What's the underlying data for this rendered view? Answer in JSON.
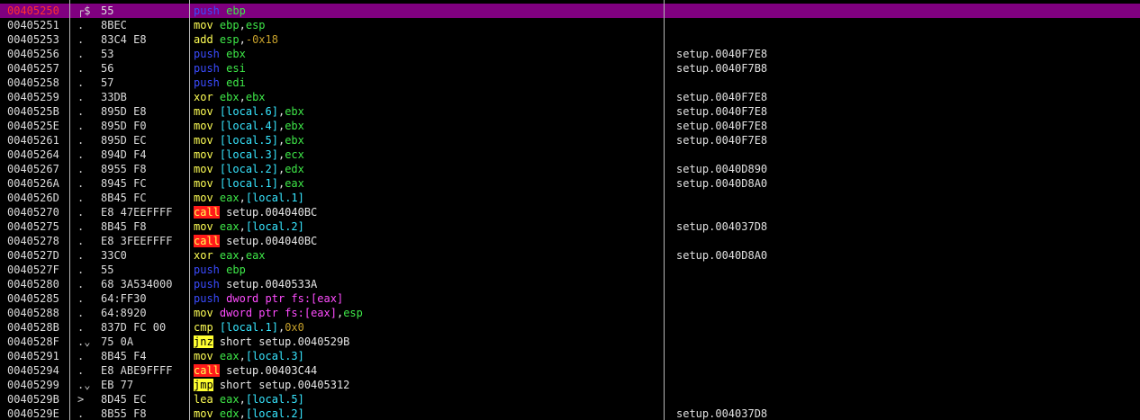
{
  "rows": [
    {
      "addr": "00405250",
      "mark": "┌$",
      "hex": "55",
      "selected": true,
      "asm": [
        [
          "push",
          "push"
        ],
        [
          " ",
          "txt"
        ],
        [
          "ebp",
          "reg"
        ]
      ],
      "comment": ""
    },
    {
      "addr": "00405251",
      "mark": ".",
      "hex": "8BEC",
      "asm": [
        [
          "mov",
          "mn"
        ],
        [
          " ",
          "txt"
        ],
        [
          "ebp",
          "reg"
        ],
        [
          ",",
          "txt"
        ],
        [
          "esp",
          "reg"
        ]
      ],
      "comment": ""
    },
    {
      "addr": "00405253",
      "mark": ".",
      "hex": "83C4 E8",
      "asm": [
        [
          "add",
          "mn"
        ],
        [
          " ",
          "txt"
        ],
        [
          "esp",
          "reg"
        ],
        [
          ",",
          "txt"
        ],
        [
          "-0x18",
          "num"
        ]
      ],
      "comment": ""
    },
    {
      "addr": "00405256",
      "mark": ".",
      "hex": "53",
      "asm": [
        [
          "push",
          "push"
        ],
        [
          " ",
          "txt"
        ],
        [
          "ebx",
          "reg"
        ]
      ],
      "comment": "setup.0040F7E8"
    },
    {
      "addr": "00405257",
      "mark": ".",
      "hex": "56",
      "asm": [
        [
          "push",
          "push"
        ],
        [
          " ",
          "txt"
        ],
        [
          "esi",
          "reg"
        ]
      ],
      "comment": "setup.0040F7B8"
    },
    {
      "addr": "00405258",
      "mark": ".",
      "hex": "57",
      "asm": [
        [
          "push",
          "push"
        ],
        [
          " ",
          "txt"
        ],
        [
          "edi",
          "reg"
        ]
      ],
      "comment": ""
    },
    {
      "addr": "00405259",
      "mark": ".",
      "hex": "33DB",
      "asm": [
        [
          "xor",
          "mn"
        ],
        [
          " ",
          "txt"
        ],
        [
          "ebx",
          "reg"
        ],
        [
          ",",
          "txt"
        ],
        [
          "ebx",
          "reg"
        ]
      ],
      "comment": "setup.0040F7E8"
    },
    {
      "addr": "0040525B",
      "mark": ".",
      "hex": "895D E8",
      "asm": [
        [
          "mov",
          "mn"
        ],
        [
          " ",
          "txt"
        ],
        [
          "[local.6]",
          "mem"
        ],
        [
          ",",
          "txt"
        ],
        [
          "ebx",
          "reg"
        ]
      ],
      "comment": "setup.0040F7E8"
    },
    {
      "addr": "0040525E",
      "mark": ".",
      "hex": "895D F0",
      "asm": [
        [
          "mov",
          "mn"
        ],
        [
          " ",
          "txt"
        ],
        [
          "[local.4]",
          "mem"
        ],
        [
          ",",
          "txt"
        ],
        [
          "ebx",
          "reg"
        ]
      ],
      "comment": "setup.0040F7E8"
    },
    {
      "addr": "00405261",
      "mark": ".",
      "hex": "895D EC",
      "asm": [
        [
          "mov",
          "mn"
        ],
        [
          " ",
          "txt"
        ],
        [
          "[local.5]",
          "mem"
        ],
        [
          ",",
          "txt"
        ],
        [
          "ebx",
          "reg"
        ]
      ],
      "comment": "setup.0040F7E8"
    },
    {
      "addr": "00405264",
      "mark": ".",
      "hex": "894D F4",
      "asm": [
        [
          "mov",
          "mn"
        ],
        [
          " ",
          "txt"
        ],
        [
          "[local.3]",
          "mem"
        ],
        [
          ",",
          "txt"
        ],
        [
          "ecx",
          "reg"
        ]
      ],
      "comment": ""
    },
    {
      "addr": "00405267",
      "mark": ".",
      "hex": "8955 F8",
      "asm": [
        [
          "mov",
          "mn"
        ],
        [
          " ",
          "txt"
        ],
        [
          "[local.2]",
          "mem"
        ],
        [
          ",",
          "txt"
        ],
        [
          "edx",
          "reg"
        ]
      ],
      "comment": "setup.0040D890"
    },
    {
      "addr": "0040526A",
      "mark": ".",
      "hex": "8945 FC",
      "asm": [
        [
          "mov",
          "mn"
        ],
        [
          " ",
          "txt"
        ],
        [
          "[local.1]",
          "mem"
        ],
        [
          ",",
          "txt"
        ],
        [
          "eax",
          "reg"
        ]
      ],
      "comment": "setup.0040D8A0"
    },
    {
      "addr": "0040526D",
      "mark": ".",
      "hex": "8B45 FC",
      "asm": [
        [
          "mov",
          "mn"
        ],
        [
          " ",
          "txt"
        ],
        [
          "eax",
          "reg"
        ],
        [
          ",",
          "txt"
        ],
        [
          "[local.1]",
          "mem"
        ]
      ],
      "comment": ""
    },
    {
      "addr": "00405270",
      "mark": ".",
      "hex": "E8 47EEFFFF",
      "asm": [
        [
          "call",
          "call"
        ],
        [
          " setup.004040BC",
          "txt"
        ]
      ],
      "comment": ""
    },
    {
      "addr": "00405275",
      "mark": ".",
      "hex": "8B45 F8",
      "asm": [
        [
          "mov",
          "mn"
        ],
        [
          " ",
          "txt"
        ],
        [
          "eax",
          "reg"
        ],
        [
          ",",
          "txt"
        ],
        [
          "[local.2]",
          "mem"
        ]
      ],
      "comment": "setup.004037D8"
    },
    {
      "addr": "00405278",
      "mark": ".",
      "hex": "E8 3FEEFFFF",
      "asm": [
        [
          "call",
          "call"
        ],
        [
          " setup.004040BC",
          "txt"
        ]
      ],
      "comment": ""
    },
    {
      "addr": "0040527D",
      "mark": ".",
      "hex": "33C0",
      "asm": [
        [
          "xor",
          "mn"
        ],
        [
          " ",
          "txt"
        ],
        [
          "eax",
          "reg"
        ],
        [
          ",",
          "txt"
        ],
        [
          "eax",
          "reg"
        ]
      ],
      "comment": "setup.0040D8A0"
    },
    {
      "addr": "0040527F",
      "mark": ".",
      "hex": "55",
      "asm": [
        [
          "push",
          "push"
        ],
        [
          " ",
          "txt"
        ],
        [
          "ebp",
          "reg"
        ]
      ],
      "comment": ""
    },
    {
      "addr": "00405280",
      "mark": ".",
      "hex": "68 3A534000",
      "asm": [
        [
          "push",
          "push"
        ],
        [
          " setup.0040533A",
          "txt"
        ]
      ],
      "comment": ""
    },
    {
      "addr": "00405285",
      "mark": ".",
      "hex": "64:FF30",
      "asm": [
        [
          "push",
          "push"
        ],
        [
          " ",
          "txt"
        ],
        [
          "dword ptr fs:[eax]",
          "seg"
        ]
      ],
      "comment": ""
    },
    {
      "addr": "00405288",
      "mark": ".",
      "hex": "64:8920",
      "asm": [
        [
          "mov",
          "mn"
        ],
        [
          " ",
          "txt"
        ],
        [
          "dword ptr fs:[eax]",
          "seg"
        ],
        [
          ",",
          "txt"
        ],
        [
          "esp",
          "reg"
        ]
      ],
      "comment": ""
    },
    {
      "addr": "0040528B",
      "mark": ".",
      "hex": "837D FC 00",
      "asm": [
        [
          "cmp",
          "mn"
        ],
        [
          " ",
          "txt"
        ],
        [
          "[local.1]",
          "mem"
        ],
        [
          ",",
          "txt"
        ],
        [
          "0x0",
          "num"
        ]
      ],
      "comment": ""
    },
    {
      "addr": "0040528F",
      "mark": ".⌄",
      "hex": "75 0A",
      "asm": [
        [
          "jnz",
          "jmp"
        ],
        [
          " short setup.0040529B",
          "txt"
        ]
      ],
      "comment": ""
    },
    {
      "addr": "00405291",
      "mark": ".",
      "hex": "8B45 F4",
      "asm": [
        [
          "mov",
          "mn"
        ],
        [
          " ",
          "txt"
        ],
        [
          "eax",
          "reg"
        ],
        [
          ",",
          "txt"
        ],
        [
          "[local.3]",
          "mem"
        ]
      ],
      "comment": ""
    },
    {
      "addr": "00405294",
      "mark": ".",
      "hex": "E8 ABE9FFFF",
      "asm": [
        [
          "call",
          "call"
        ],
        [
          " setup.00403C44",
          "txt"
        ]
      ],
      "comment": ""
    },
    {
      "addr": "00405299",
      "mark": ".⌄",
      "hex": "EB 77",
      "asm": [
        [
          "jmp",
          "jmp"
        ],
        [
          " short setup.00405312",
          "txt"
        ]
      ],
      "comment": ""
    },
    {
      "addr": "0040529B",
      "mark": ">",
      "hex": "8D45 EC",
      "asm": [
        [
          "lea",
          "mn"
        ],
        [
          " ",
          "txt"
        ],
        [
          "eax",
          "reg"
        ],
        [
          ",",
          "txt"
        ],
        [
          "[local.5]",
          "mem"
        ]
      ],
      "comment": ""
    },
    {
      "addr": "0040529E",
      "mark": ".",
      "hex": "8B55 F8",
      "asm": [
        [
          "mov",
          "mn"
        ],
        [
          " ",
          "txt"
        ],
        [
          "edx",
          "reg"
        ],
        [
          ",",
          "txt"
        ],
        [
          "[local.2]",
          "mem"
        ]
      ],
      "comment": "setup.004037D8"
    }
  ]
}
